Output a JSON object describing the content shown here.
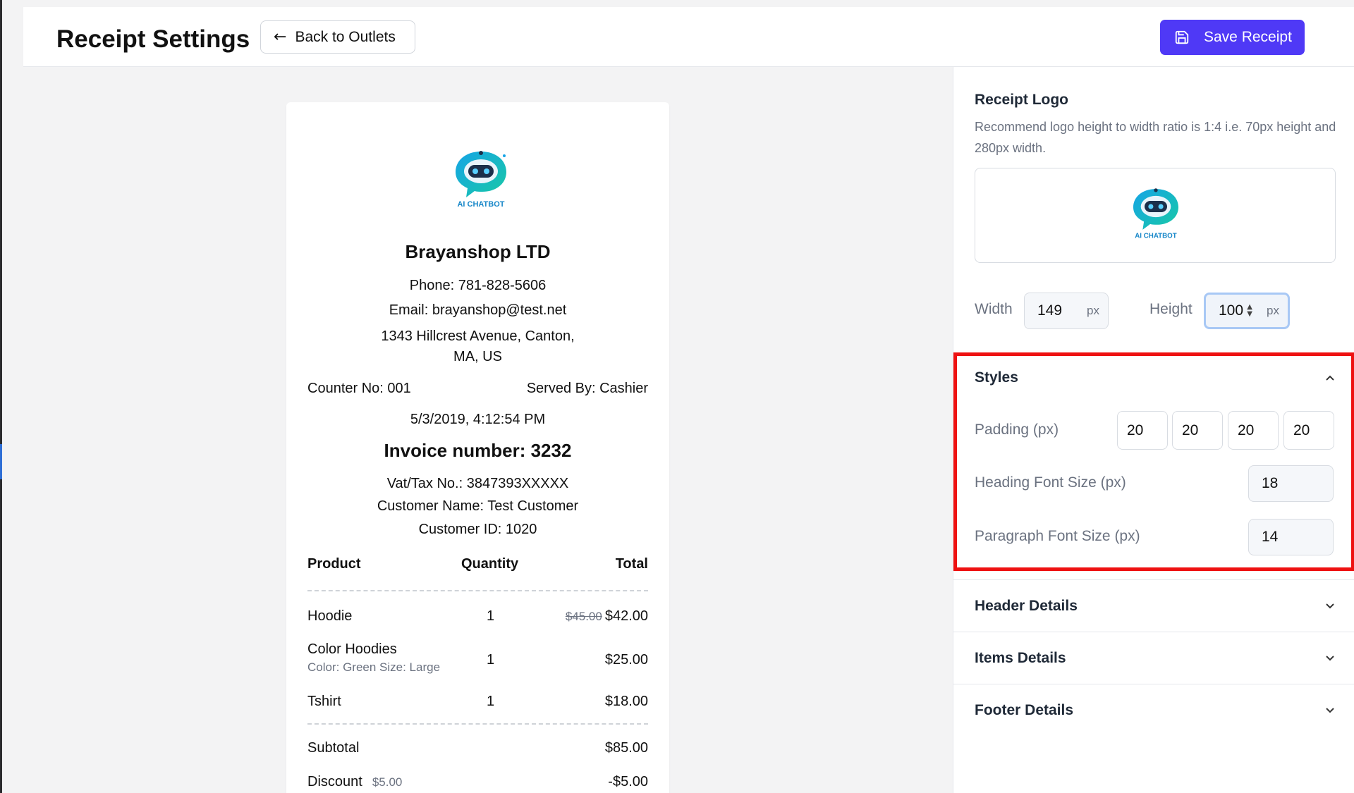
{
  "header": {
    "title": "Receipt Settings",
    "back_label": "Back to Outlets",
    "save_label": "Save Receipt",
    "accent_color": "#4f39f6"
  },
  "receipt": {
    "logo_text": "AI CHATBOT",
    "shop_name": "Brayanshop LTD",
    "phone": "Phone: 781-828-5606",
    "email": "Email: brayanshop@test.net",
    "address_line1": "1343 Hillcrest Avenue, Canton,",
    "address_line2": "MA, US",
    "counter": "Counter No: 001",
    "served_by": "Served By: Cashier",
    "datetime": "5/3/2019, 4:12:54 PM",
    "invoice": "Invoice number: 3232",
    "vat": "Vat/Tax No.: 3847393XXXXX",
    "customer_name": "Customer Name: Test Customer",
    "customer_id": "Customer ID: 1020",
    "columns": {
      "product": "Product",
      "quantity": "Quantity",
      "total": "Total"
    },
    "items": [
      {
        "name": "Hoodie",
        "variant": "",
        "qty": "1",
        "old_price": "$45.00",
        "total": "$42.00"
      },
      {
        "name": "Color Hoodies",
        "variant": "Color: Green  Size: Large",
        "qty": "1",
        "old_price": "",
        "total": "$25.00"
      },
      {
        "name": "Tshirt",
        "variant": "",
        "qty": "1",
        "old_price": "",
        "total": "$18.00"
      }
    ],
    "subtotal_label": "Subtotal",
    "subtotal_value": "$85.00",
    "discount_label": "Discount",
    "discount_note": "$5.00",
    "discount_value": "-$5.00"
  },
  "panel": {
    "logo_title": "Receipt Logo",
    "logo_hint": "Recommend logo height to width ratio is 1:4 i.e. 70px height and 280px width.",
    "width_label": "Width",
    "width_value": "149",
    "height_label": "Height",
    "height_value": "100",
    "unit": "px",
    "styles": {
      "title": "Styles",
      "padding_label": "Padding (px)",
      "padding": [
        "20",
        "20",
        "20",
        "20"
      ],
      "heading_label": "Heading Font Size (px)",
      "heading_value": "18",
      "paragraph_label": "Paragraph Font Size (px)",
      "paragraph_value": "14",
      "highlight_color": "#ee1111"
    },
    "sections": [
      "Header Details",
      "Items Details",
      "Footer Details"
    ]
  }
}
